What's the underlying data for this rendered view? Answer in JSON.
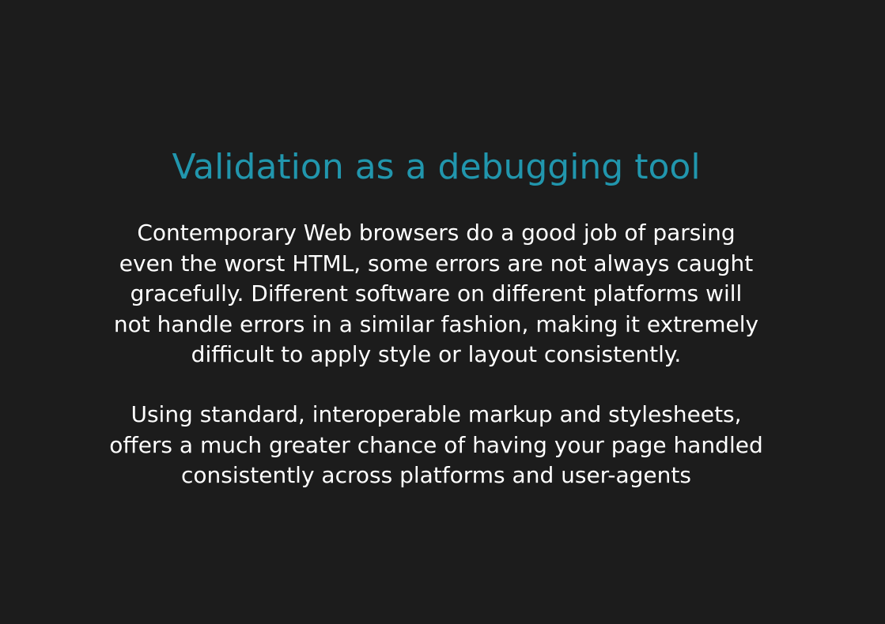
{
  "slide": {
    "title": "Validation as a debugging tool",
    "paragraph1": {
      "lines": [
        "Contemporary Web browsers do a good job of parsing",
        "even the worst HTML, some errors are not always caught",
        "gracefully. Different software on different platforms will",
        "not handle errors in a similar fashion, making it extremely",
        "difficult to apply style or layout consistently."
      ]
    },
    "paragraph2": {
      "lines": [
        "Using standard, interoperable markup and stylesheets,",
        "offers a much greater chance of having your page handled",
        "consistently across platforms and user-agents"
      ]
    }
  },
  "colors": {
    "background": "#1c1c1c",
    "title": "#2196ad",
    "body_text": "#ffffff"
  }
}
